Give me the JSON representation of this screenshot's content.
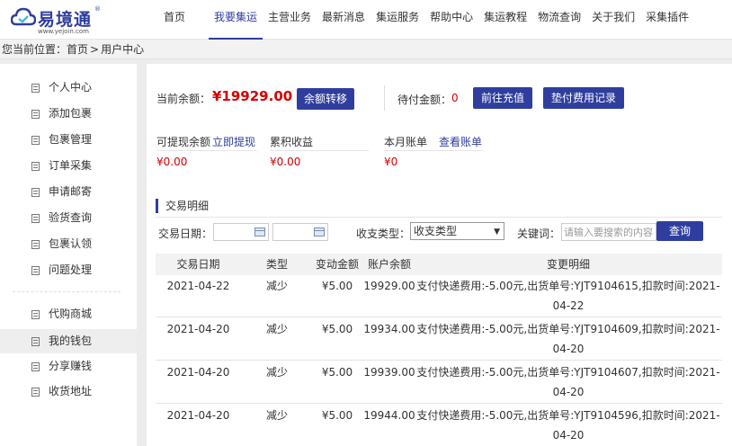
{
  "logo": {
    "name": "易境通",
    "registered": "®",
    "url": "www.yejoin.com"
  },
  "nav": {
    "items": [
      "首页",
      "我要集运",
      "主营业务",
      "最新消息",
      "集运服务",
      "帮助中心",
      "集运教程",
      "物流查询",
      "关于我们",
      "采集插件"
    ],
    "active_index": 1
  },
  "breadcrumb": {
    "prefix": "您当前位置：",
    "home": "首页",
    "separator": ">",
    "current": "用户中心"
  },
  "sidebar": {
    "group1": [
      "个人中心",
      "添加包裹",
      "包裹管理",
      "订单采集",
      "申请邮寄",
      "验货查询",
      "包裹认领",
      "问题处理"
    ],
    "group2": [
      "代购商城",
      "我的钱包",
      "分享赚钱",
      "收货地址"
    ],
    "active": "我的钱包"
  },
  "wallet": {
    "balance_label": "当前余额：",
    "balance_value": "¥19929.00",
    "transfer_button": "余额转移",
    "pending_label": "待付金额：",
    "pending_value": "0",
    "recharge_button": "前往充值",
    "advance_button": "垫付费用记录",
    "withdrawable_label": "可提现余额",
    "withdraw_link": "立即提现",
    "withdrawable_value": "¥0.00",
    "earnings_label": "累积收益",
    "earnings_value": "¥0.00",
    "bill_label": "本月账单",
    "bill_link": "查看账单",
    "bill_value": "¥0"
  },
  "transactions": {
    "title": "交易明细",
    "date_label": "交易日期：",
    "type_label": "收支类型：",
    "type_selected": "收支类型",
    "keyword_label": "关键词：",
    "keyword_placeholder": "请输入要搜索的内容",
    "query_button": "查询",
    "columns": [
      "交易日期",
      "类型",
      "变动金额",
      "账户余额",
      "变更明细"
    ],
    "rows": [
      {
        "date": "2021-04-22",
        "type": "减少",
        "amount": "¥5.00",
        "balance": "19929.00",
        "detail": "支付快递费用:-5.00元,出货单号:YJT9104615,扣款时间:2021-04-22"
      },
      {
        "date": "2021-04-20",
        "type": "减少",
        "amount": "¥5.00",
        "balance": "19934.00",
        "detail": "支付快递费用:-5.00元,出货单号:YJT9104609,扣款时间:2021-04-20"
      },
      {
        "date": "2021-04-20",
        "type": "减少",
        "amount": "¥5.00",
        "balance": "19939.00",
        "detail": "支付快递费用:-5.00元,出货单号:YJT9104607,扣款时间:2021-04-20"
      },
      {
        "date": "2021-04-20",
        "type": "减少",
        "amount": "¥5.00",
        "balance": "19944.00",
        "detail": "支付快递费用:-5.00元,出货单号:YJT9104596,扣款时间:2021-04-20"
      }
    ]
  },
  "colors": {
    "brand": "#2f3e9e",
    "money": "#d40000"
  },
  "icons": {
    "logo": "cloud-logo-icon",
    "sidebar": "list-icon",
    "calendar": "calendar-icon",
    "select": "chevron-down-icon"
  }
}
